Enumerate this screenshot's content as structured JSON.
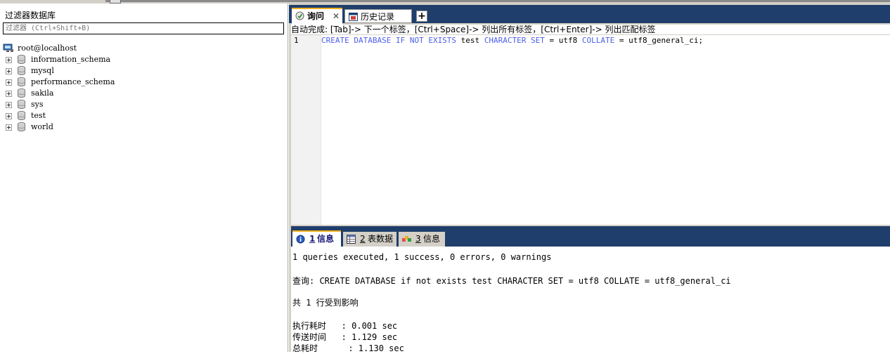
{
  "left_panel": {
    "filter_title": "过滤器数据库",
    "filter_placeholder": "过滤器 (Ctrl+Shift+B)",
    "server": "root@localhost",
    "databases": [
      "information_schema",
      "mysql",
      "performance_schema",
      "sakila",
      "sys",
      "test",
      "world"
    ]
  },
  "tabs": {
    "query_tab": "询问",
    "history_tab": "历史记录",
    "close_glyph": "✕",
    "add_glyph": "+"
  },
  "editor": {
    "autocomplete_hint": "自动完成: [Tab]-> 下一个标签，[Ctrl+Space]-> 列出所有标签，[Ctrl+Enter]-> 列出匹配标签",
    "line_number": "1",
    "code": {
      "kw1": "CREATE DATABASE IF NOT EXISTS",
      "name": " test ",
      "kw2": "CHARACTER SET",
      "eq1": " = utf8 ",
      "kw3": "COLLATE",
      "eq2": " = utf8_general_ci;"
    }
  },
  "result_tabs": [
    {
      "num": "1",
      "label": "信息"
    },
    {
      "num": "2",
      "label": "表数据"
    },
    {
      "num": "3",
      "label": "信息"
    }
  ],
  "results": {
    "summary": "1 queries executed, 1 success, 0 errors, 0 warnings",
    "query": "查询: CREATE DATABASE if not exists test CHARACTER SET = utf8 COLLATE = utf8_general_ci",
    "affected": "共 1 行受到影响",
    "exec_time": "执行耗时   : 0.001 sec",
    "transfer_time": "传送时间   : 1.129 sec",
    "total_time": "总耗时      : 1.130 sec"
  },
  "colors": {
    "keyword": "#4d60e8",
    "tab_bar": "#1f3e6b",
    "active_tab_accent": "#f0b020"
  }
}
